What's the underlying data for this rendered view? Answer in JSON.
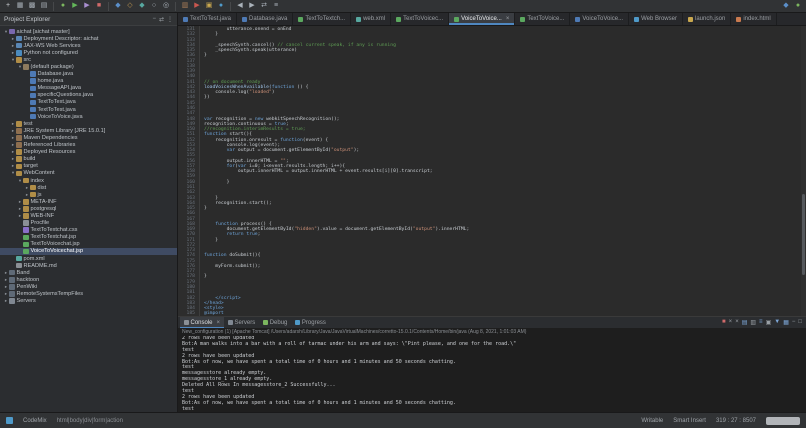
{
  "toolbar": {
    "icons": [
      {
        "name": "new-wizard-icon",
        "glyph": "+",
        "color": "#cfd2d6"
      },
      {
        "name": "save-icon",
        "glyph": "▦",
        "color": "#aab2ba"
      },
      {
        "name": "save-all-icon",
        "glyph": "▩",
        "color": "#aab2ba"
      },
      {
        "name": "print-icon",
        "glyph": "▤",
        "color": "#aab2ba"
      },
      {
        "name": "separator"
      },
      {
        "name": "debug-icon",
        "glyph": "●",
        "color": "#7cb65f"
      },
      {
        "name": "run-icon",
        "glyph": "▶",
        "color": "#63b75a"
      },
      {
        "name": "profile-icon",
        "glyph": "▶",
        "color": "#a98fd0"
      },
      {
        "name": "stop-icon",
        "glyph": "■",
        "color": "#d06a6a"
      },
      {
        "name": "separator"
      },
      {
        "name": "new-java-class-icon",
        "glyph": "◆",
        "color": "#5b8fc9"
      },
      {
        "name": "new-package-icon",
        "glyph": "◇",
        "color": "#c49a52"
      },
      {
        "name": "new-servlet-icon",
        "glyph": "◆",
        "color": "#57a8a0"
      },
      {
        "name": "open-type-icon",
        "glyph": "○",
        "color": "#aab2ba"
      },
      {
        "name": "search-icon",
        "glyph": "◎",
        "color": "#aab2ba"
      },
      {
        "name": "separator"
      },
      {
        "name": "coverage-icon",
        "glyph": "▥",
        "color": "#b0825a"
      },
      {
        "name": "external-tools-icon",
        "glyph": "▶",
        "color": "#c9574f"
      },
      {
        "name": "database-icon",
        "glyph": "▣",
        "color": "#c9a84f"
      },
      {
        "name": "web-browser-icon",
        "glyph": "●",
        "color": "#4f9ac9"
      },
      {
        "name": "separator"
      },
      {
        "name": "back-icon",
        "glyph": "◀",
        "color": "#aab2ba"
      },
      {
        "name": "forward-icon",
        "glyph": "▶",
        "color": "#aab2ba"
      },
      {
        "name": "last-edit-location-icon",
        "glyph": "⇄",
        "color": "#aab2ba"
      },
      {
        "name": "link-with-editor-icon",
        "glyph": "≡",
        "color": "#aab2ba"
      }
    ],
    "right_icons": [
      {
        "name": "perspective-java-ee-icon",
        "glyph": "◆",
        "color": "#5b8fc9"
      },
      {
        "name": "perspective-debug-icon",
        "glyph": "●",
        "color": "#7cb65f"
      }
    ]
  },
  "project_explorer": {
    "title": "Project Explorer",
    "header_icons": [
      {
        "name": "collapse-all-icon",
        "glyph": "−"
      },
      {
        "name": "link-with-editor-icon",
        "glyph": "⇄"
      },
      {
        "name": "view-menu-icon",
        "glyph": "⋮"
      }
    ],
    "tree": [
      {
        "label": "aichat [aichat master]",
        "depth": 0,
        "icon": "project",
        "arrow": "open"
      },
      {
        "label": "Deployment Descriptor: aichat",
        "depth": 1,
        "icon": "descriptor",
        "arrow": "closed"
      },
      {
        "label": "JAX-WS Web Services",
        "depth": 1,
        "icon": "services",
        "arrow": "closed"
      },
      {
        "label": "Python not configured",
        "depth": 1,
        "icon": "python",
        "arrow": "closed"
      },
      {
        "label": "src",
        "depth": 1,
        "icon": "src",
        "arrow": "open"
      },
      {
        "label": "(default package)",
        "depth": 2,
        "icon": "package",
        "arrow": "open"
      },
      {
        "label": "Database.java",
        "depth": 3,
        "icon": "java"
      },
      {
        "label": "home.java",
        "depth": 3,
        "icon": "java"
      },
      {
        "label": "MessageAPI.java",
        "depth": 3,
        "icon": "java"
      },
      {
        "label": "specificQuestions.java",
        "depth": 3,
        "icon": "java"
      },
      {
        "label": "TextToText.java",
        "depth": 3,
        "icon": "java"
      },
      {
        "label": "TextToTest.java",
        "depth": 3,
        "icon": "java"
      },
      {
        "label": "VoiceToVoice.java",
        "depth": 3,
        "icon": "java"
      },
      {
        "label": "test",
        "depth": 1,
        "icon": "src",
        "arrow": "closed"
      },
      {
        "label": "JRE System Library [JRE 15.0.1]",
        "depth": 1,
        "icon": "library",
        "arrow": "closed"
      },
      {
        "label": "Maven Dependencies",
        "depth": 1,
        "icon": "library",
        "arrow": "closed"
      },
      {
        "label": "Referenced Libraries",
        "depth": 1,
        "icon": "library",
        "arrow": "closed"
      },
      {
        "label": "Deployed Resources",
        "depth": 1,
        "icon": "folder",
        "arrow": "closed"
      },
      {
        "label": "build",
        "depth": 1,
        "icon": "folder",
        "arrow": "closed"
      },
      {
        "label": "target",
        "depth": 1,
        "icon": "folder",
        "arrow": "closed"
      },
      {
        "label": "WebContent",
        "depth": 1,
        "icon": "folder",
        "arrow": "open"
      },
      {
        "label": "index",
        "depth": 2,
        "icon": "folder",
        "arrow": "open"
      },
      {
        "label": "dist",
        "depth": 3,
        "icon": "folder",
        "arrow": "closed"
      },
      {
        "label": "js",
        "depth": 3,
        "icon": "folder",
        "arrow": "closed"
      },
      {
        "label": "META-INF",
        "depth": 2,
        "icon": "folder",
        "arrow": "closed"
      },
      {
        "label": "postgresql",
        "depth": 2,
        "icon": "folder",
        "arrow": "closed"
      },
      {
        "label": "WEB-INF",
        "depth": 2,
        "icon": "folder",
        "arrow": "closed"
      },
      {
        "label": "Procfile",
        "depth": 2,
        "icon": "file"
      },
      {
        "label": "TextToTextchat.css",
        "depth": 2,
        "icon": "css"
      },
      {
        "label": "TextToTextchat.jsp",
        "depth": 2,
        "icon": "jsp"
      },
      {
        "label": "TextToVoicechat.jsp",
        "depth": 2,
        "icon": "jsp"
      },
      {
        "label": "VoiceToVoicechat.jsp",
        "depth": 2,
        "icon": "jsp",
        "selected": true
      },
      {
        "label": "pom.xml",
        "depth": 1,
        "icon": "xml"
      },
      {
        "label": "README.md",
        "depth": 1,
        "icon": "file"
      },
      {
        "label": "Band",
        "depth": 0,
        "icon": "project-closed",
        "arrow": "closed"
      },
      {
        "label": "hacktoon",
        "depth": 0,
        "icon": "project-closed",
        "arrow": "closed"
      },
      {
        "label": "PenWiki",
        "depth": 0,
        "icon": "project-closed",
        "arrow": "closed"
      },
      {
        "label": "RemoteSystemsTempFiles",
        "depth": 0,
        "icon": "project-closed",
        "arrow": "closed"
      },
      {
        "label": "Servers",
        "depth": 0,
        "icon": "server",
        "arrow": "closed"
      }
    ]
  },
  "editor_tabs": [
    {
      "label": "TextToTest.java",
      "icon": "java"
    },
    {
      "label": "Database.java",
      "icon": "java"
    },
    {
      "label": "TextToTextch...",
      "icon": "jsp"
    },
    {
      "label": "web.xml",
      "icon": "xml"
    },
    {
      "label": "TextToVoicec...",
      "icon": "jsp"
    },
    {
      "label": "VoiceToVoice...",
      "icon": "jsp",
      "active": true,
      "close": true
    },
    {
      "label": "TextToVoice...",
      "icon": "jsp"
    },
    {
      "label": "VoiceToVoice...",
      "icon": "java"
    },
    {
      "label": "Web Browser",
      "icon": "browser"
    },
    {
      "label": "launch.json",
      "icon": "json"
    },
    {
      "label": "index.html",
      "icon": "html"
    }
  ],
  "editor": {
    "lines": [
      {
        "n": 131,
        "s": [
          [
            "        utterance.onend = onEnd",
            "d"
          ]
        ]
      },
      {
        "n": 132,
        "s": [
          [
            "    }",
            "d"
          ]
        ]
      },
      {
        "n": 133,
        "s": []
      },
      {
        "n": 134,
        "s": [
          [
            "    _speechSynth.cancel() ",
            "d"
          ],
          [
            "// cancel current speak, if any is running",
            "c"
          ]
        ]
      },
      {
        "n": 135,
        "s": [
          [
            "    _speechSynth.speak(utterance)",
            "d"
          ]
        ]
      },
      {
        "n": 136,
        "s": [
          [
            "}",
            "d"
          ]
        ]
      },
      {
        "n": 137,
        "s": []
      },
      {
        "n": 138,
        "s": []
      },
      {
        "n": 139,
        "s": []
      },
      {
        "n": 140,
        "s": []
      },
      {
        "n": 141,
        "s": [
          [
            "// on document ready",
            "c"
          ]
        ]
      },
      {
        "n": 142,
        "s": [
          [
            "loadVoicesWhenAvailable(",
            "f"
          ],
          [
            "function",
            "k"
          ],
          [
            " () {",
            "d"
          ]
        ]
      },
      {
        "n": 143,
        "s": [
          [
            "    console.log(",
            "d"
          ],
          [
            "\"loaded\"",
            "s"
          ],
          [
            ")",
            "d"
          ]
        ]
      },
      {
        "n": 144,
        "s": [
          [
            "})",
            "d"
          ]
        ]
      },
      {
        "n": 145,
        "s": []
      },
      {
        "n": 146,
        "s": []
      },
      {
        "n": 147,
        "s": []
      },
      {
        "n": 148,
        "s": [
          [
            "var",
            "k"
          ],
          [
            " recognition = ",
            "d"
          ],
          [
            "new",
            "k"
          ],
          [
            " webkitSpeechRecognition();",
            "d"
          ]
        ]
      },
      {
        "n": 149,
        "s": [
          [
            "recognition.continuous = ",
            "d"
          ],
          [
            "true",
            "k"
          ],
          [
            ";",
            "d"
          ]
        ]
      },
      {
        "n": 150,
        "s": [
          [
            "//recognition.interimResults = true;",
            "c"
          ]
        ]
      },
      {
        "n": 151,
        "s": [
          [
            "function",
            "k"
          ],
          [
            " start(){",
            "d"
          ]
        ]
      },
      {
        "n": 152,
        "s": [
          [
            "    recognition.onresult = ",
            "d"
          ],
          [
            "function",
            "k"
          ],
          [
            "(event) {",
            "d"
          ]
        ]
      },
      {
        "n": 153,
        "s": [
          [
            "        console.log(event);",
            "d"
          ]
        ]
      },
      {
        "n": 154,
        "s": [
          [
            "        ",
            "d"
          ],
          [
            "var",
            "k"
          ],
          [
            " output = document.getElementById(",
            "d"
          ],
          [
            "\"output\"",
            "s"
          ],
          [
            ");",
            "d"
          ]
        ]
      },
      {
        "n": 155,
        "s": []
      },
      {
        "n": 156,
        "s": [
          [
            "        output.innerHTML = ",
            "d"
          ],
          [
            "\"\"",
            "s"
          ],
          [
            ";",
            "d"
          ]
        ]
      },
      {
        "n": 157,
        "s": [
          [
            "        ",
            "d"
          ],
          [
            "for",
            "k"
          ],
          [
            "(",
            "d"
          ],
          [
            "var",
            "k"
          ],
          [
            " i=0; i<event.results.length; i++){",
            "d"
          ]
        ]
      },
      {
        "n": 158,
        "s": [
          [
            "            output.innerHTML = output.innerHTML + event.results[i][0].transcript;",
            "d"
          ]
        ]
      },
      {
        "n": 159,
        "s": []
      },
      {
        "n": 160,
        "s": [
          [
            "        }",
            "d"
          ]
        ]
      },
      {
        "n": 161,
        "s": []
      },
      {
        "n": 162,
        "s": []
      },
      {
        "n": 163,
        "s": [
          [
            "    }",
            "d"
          ]
        ]
      },
      {
        "n": 164,
        "s": [
          [
            "    recognition.start();",
            "d"
          ]
        ]
      },
      {
        "n": 165,
        "s": [
          [
            "}",
            "d"
          ]
        ]
      },
      {
        "n": 166,
        "s": []
      },
      {
        "n": 167,
        "s": []
      },
      {
        "n": 168,
        "s": [
          [
            "    ",
            "d"
          ],
          [
            "function",
            "k"
          ],
          [
            " process() {",
            "d"
          ]
        ]
      },
      {
        "n": 169,
        "s": [
          [
            "        document.getElementById(",
            "d"
          ],
          [
            "\"hidden\"",
            "s"
          ],
          [
            ").value = document.getElementById(",
            "d"
          ],
          [
            "\"output\"",
            "s"
          ],
          [
            ").innerHTML;",
            "d"
          ]
        ]
      },
      {
        "n": 170,
        "s": [
          [
            "        ",
            "d"
          ],
          [
            "return",
            "k"
          ],
          [
            " ",
            "d"
          ],
          [
            "true",
            "k"
          ],
          [
            ";",
            "d"
          ]
        ]
      },
      {
        "n": 171,
        "s": [
          [
            "    }",
            "d"
          ]
        ]
      },
      {
        "n": 172,
        "s": []
      },
      {
        "n": 173,
        "s": []
      },
      {
        "n": 174,
        "s": [
          [
            "function",
            "k"
          ],
          [
            " doSubmit(){",
            "d"
          ]
        ]
      },
      {
        "n": 175,
        "s": []
      },
      {
        "n": 176,
        "s": [
          [
            "    myForm.submit();",
            "d"
          ]
        ]
      },
      {
        "n": 177,
        "s": []
      },
      {
        "n": 178,
        "s": [
          [
            "}",
            "d"
          ]
        ]
      },
      {
        "n": 179,
        "s": []
      },
      {
        "n": 180,
        "s": []
      },
      {
        "n": 181,
        "s": []
      },
      {
        "n": 182,
        "s": [
          [
            "    </script>",
            "t"
          ]
        ]
      },
      {
        "n": 183,
        "s": [
          [
            "</head>",
            "t"
          ]
        ]
      },
      {
        "n": 184,
        "s": [
          [
            "<style>",
            "t"
          ]
        ]
      },
      {
        "n": 185,
        "s": [
          [
            "@import",
            "k"
          ]
        ]
      }
    ]
  },
  "console": {
    "tabs": [
      {
        "label": "Console",
        "icon": "console",
        "active": true,
        "close": true
      },
      {
        "label": "Servers",
        "icon": "server"
      },
      {
        "label": "Debug",
        "icon": "debug"
      },
      {
        "label": "Progress",
        "icon": "progress"
      }
    ],
    "toolbar_icons": [
      {
        "name": "terminate-icon",
        "glyph": "■",
        "color": "#d06a6a"
      },
      {
        "name": "remove-launch-icon",
        "glyph": "×",
        "color": "#9aa0a6"
      },
      {
        "name": "remove-all-launches-icon",
        "glyph": "×",
        "color": "#9aa0a6"
      },
      {
        "name": "clear-console-icon",
        "glyph": "▤",
        "color": "#7da7d8"
      },
      {
        "name": "scroll-lock-icon",
        "glyph": "▥",
        "color": "#9aa0a6"
      },
      {
        "name": "word-wrap-icon",
        "glyph": "≡",
        "color": "#7da7d8"
      },
      {
        "name": "pin-console-icon",
        "glyph": "▣",
        "color": "#9aa0a6"
      },
      {
        "name": "display-selected-console-icon",
        "glyph": "▼",
        "color": "#7da7d8"
      },
      {
        "name": "open-console-icon",
        "glyph": "▦",
        "color": "#7da7d8"
      },
      {
        "name": "minimize-icon",
        "glyph": "−",
        "color": "#9aa0a6"
      },
      {
        "name": "maximize-icon",
        "glyph": "□",
        "color": "#9aa0a6"
      }
    ],
    "header": "New_configuration (1) [Apache Tomcat] /Users/adarsh/Library/Java/JavaVirtualMachines/corretto-15.0.1/Contents/Home/bin/java (Aug 8, 2021, 1:01:03 AM)",
    "lines": [
      "2 rows have been updated",
      "Bot:A man walks into a bar with a roll of tarmac under his arm and says: \\\"Pint please, and one for the road.\\\"",
      "test",
      "2 rows have been updated",
      "Bot:As of now, we have spent a total time of 0 hours and 1 minutes and 50 seconds chatting.",
      "test",
      "messagesstore already empty.",
      "messagesstore_1 already empty.",
      "Deleted All Rows In messagesstore_2 Successfully...",
      "test",
      "2 rows have been updated",
      "Bot:As of now, we have spent a total time of 0 hours and 1 minutes and 50 seconds chatting.",
      "test"
    ]
  },
  "status_bar": {
    "left": "CodeMix",
    "path": "html|body|div|form|action",
    "writable": "Writable",
    "mode": "Smart Insert",
    "position": "319 : 27 : 8507"
  }
}
